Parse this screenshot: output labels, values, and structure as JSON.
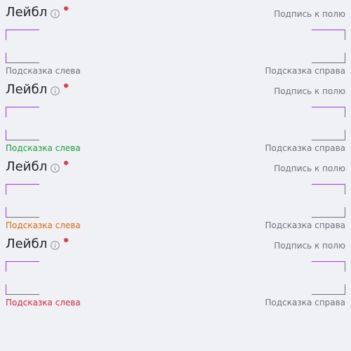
{
  "accent_color": "#8a4fd1",
  "required_color": "#e8344a",
  "fields": [
    {
      "label": "Лейбл",
      "caption": "Подпись к полю",
      "hint_left": "Подсказка слева",
      "hint_right": "Подсказка справа",
      "hint_left_color": "#6e717a",
      "state": "default"
    },
    {
      "label": "Лейбл",
      "caption": "Подпись к полю",
      "hint_left": "Подсказка слева",
      "hint_right": "Подсказка справа",
      "hint_left_color": "#1f9a3c",
      "state": "success"
    },
    {
      "label": "Лейбл",
      "caption": "Подпись к полю",
      "hint_left": "Подсказка слева",
      "hint_right": "Подсказка справа",
      "hint_left_color": "#e26a1b",
      "state": "warning"
    },
    {
      "label": "Лейбл",
      "caption": "Подпись к полю",
      "hint_left": "Подсказка слева",
      "hint_right": "Подсказка справа",
      "hint_left_color": "#e02b3c",
      "state": "error"
    }
  ],
  "icons": {
    "info": "info-icon",
    "required": "required-dot"
  }
}
